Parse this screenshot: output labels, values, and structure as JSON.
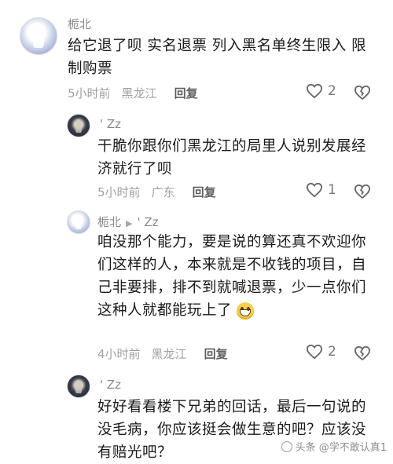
{
  "comments": [
    {
      "user": "栀北",
      "text": "给它退了呗 实名退票 列入黑名单终生限入 限制购票",
      "time": "5小时前",
      "location": "黑龙江",
      "reply_label": "回复",
      "likes": "2"
    },
    {
      "user": "' Zz",
      "text": "干脆你跟你们黑龙江的局里人说别发展经济就行了呗",
      "time": "5小时前",
      "location": "广东",
      "reply_label": "回复",
      "likes": "1"
    },
    {
      "user": "栀北",
      "reply_to": "' Zz",
      "text": "咱没那个能力，要是说的算还真不欢迎你们这样的人，本来就是不收钱的项目，自己非要排，排不到就喊退票，少一点你们这种人就都能玩上了",
      "time": "4小时前",
      "location": "黑龙江",
      "reply_label": "回复",
      "likes": "2"
    },
    {
      "user": "' Zz",
      "text": "好好看看楼下兄弟的回话，最后一句说的没毛病，你应该挺会做生意的吧？应该没有赔光吧？"
    }
  ],
  "watermark": "头条 @学不敢认真1"
}
